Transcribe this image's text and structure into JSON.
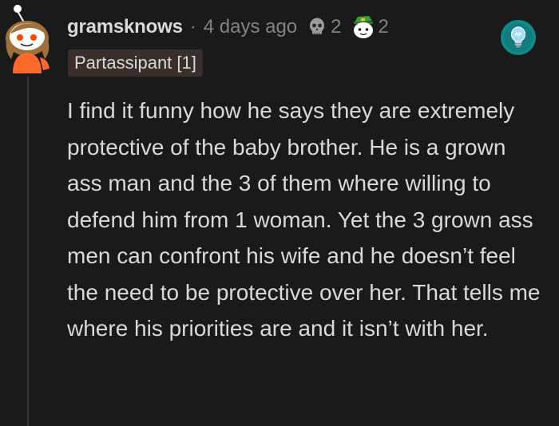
{
  "comment": {
    "username": "gramsknows",
    "separator": "·",
    "timestamp": "4 days ago",
    "awards": [
      {
        "icon": "skull-award-icon",
        "count": "2"
      },
      {
        "icon": "leprechaun-award-icon",
        "count": "2"
      }
    ],
    "flair": "Partassipant [1]",
    "badge_icon": "lightbulb-icon",
    "body": "I find it funny how he says they are extremely protective of the baby brother. He is a grown ass man and the 3 of them where willing to defend him from 1 woman. Yet the 3 grown ass men can confront his wife and he doesn’t feel the need to be protective over her. That tells me where his priorities are and it isn’t with her."
  },
  "colors": {
    "background": "#1a1a1b",
    "text": "#d7dadc",
    "muted": "#818384",
    "flair_bg": "#3a2f2a",
    "badge_teal": "#0e8a8a"
  }
}
